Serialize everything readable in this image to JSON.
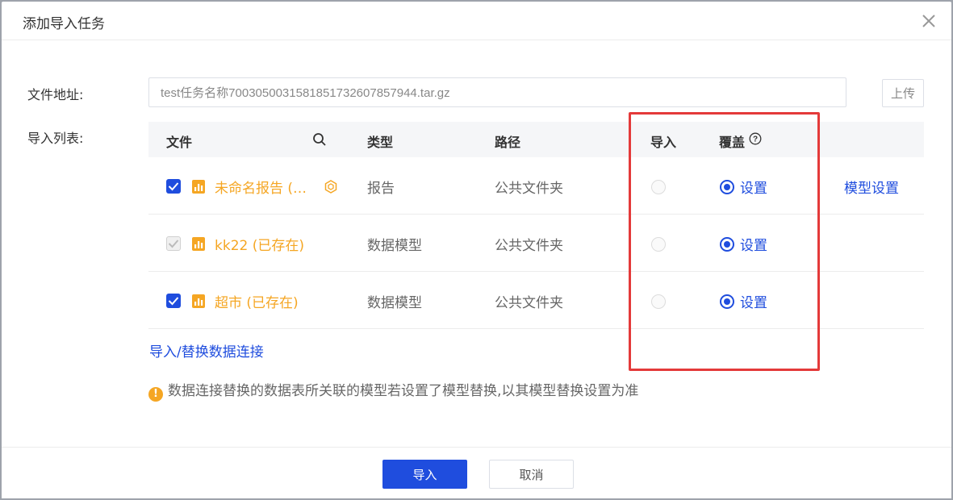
{
  "dialog": {
    "title": "添加导入任务"
  },
  "form": {
    "address_label": "文件地址:",
    "address_value": "test任务名称7003050031581851732607857944.tar.gz",
    "upload_label": "上传",
    "list_label": "导入列表:"
  },
  "table": {
    "headers": {
      "file": "文件",
      "type": "类型",
      "path": "路径",
      "import": "导入",
      "overwrite": "覆盖"
    },
    "rows": [
      {
        "checked": true,
        "disabled": false,
        "name": "未命名报告 (…",
        "type": "报告",
        "path": "公共文件夹",
        "overwrite": "设置",
        "extra_link": "模型设置"
      },
      {
        "checked": true,
        "disabled": true,
        "name": "kk22 (已存在)",
        "type": "数据模型",
        "path": "公共文件夹",
        "overwrite": "设置"
      },
      {
        "checked": true,
        "disabled": false,
        "name": "超市 (已存在)",
        "type": "数据模型",
        "path": "公共文件夹",
        "overwrite": "设置"
      }
    ]
  },
  "links": {
    "replace_connection": "导入/替换数据连接"
  },
  "tip": {
    "text": "数据连接替换的数据表所关联的模型若设置了模型替换,以其模型替换设置为准"
  },
  "footer": {
    "confirm_label": "导入",
    "cancel_label": "取消"
  },
  "colors": {
    "primary": "#1f4dde",
    "file_name": "#f5a623",
    "highlight_box": "#e43a3a"
  }
}
